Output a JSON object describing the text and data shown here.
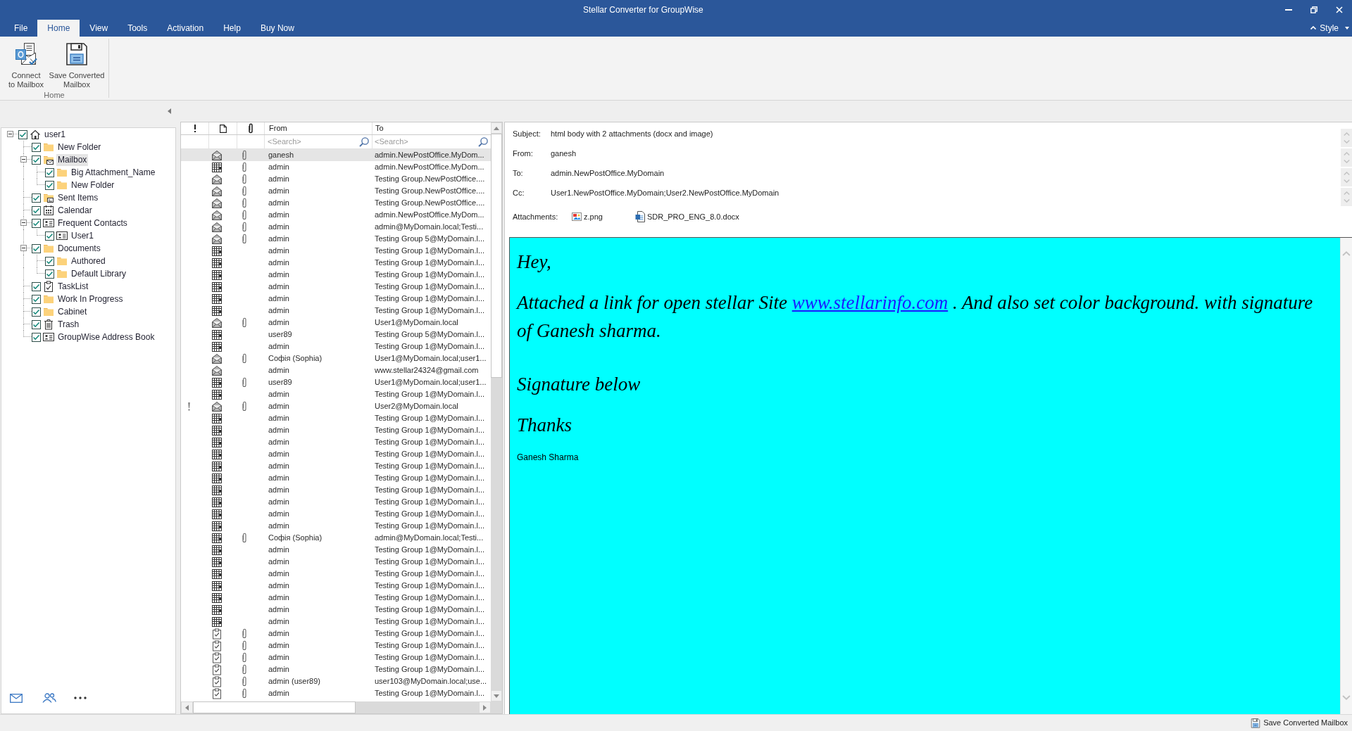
{
  "window": {
    "title": "Stellar Converter for GroupWise"
  },
  "menu_tabs": [
    {
      "label": "File",
      "selected": false
    },
    {
      "label": "Home",
      "selected": true
    },
    {
      "label": "View",
      "selected": false
    },
    {
      "label": "Tools",
      "selected": false
    },
    {
      "label": "Activation",
      "selected": false
    },
    {
      "label": "Help",
      "selected": false
    },
    {
      "label": "Buy Now",
      "selected": false
    }
  ],
  "style_menu": {
    "label": "Style"
  },
  "ribbon": {
    "buttons": [
      {
        "kind": "connect",
        "label_lines": [
          "Connect",
          "to Mailbox"
        ]
      },
      {
        "kind": "save",
        "label_lines": [
          "Save Converted",
          "Mailbox"
        ]
      }
    ],
    "group_label": "Home"
  },
  "folder_tree": [
    {
      "label": "user1",
      "kind": "user",
      "checked": true,
      "expanded": true,
      "selected": false,
      "children": [
        {
          "label": "New Folder",
          "kind": "folder",
          "checked": true,
          "selected": false
        },
        {
          "label": "Mailbox",
          "kind": "mailbox",
          "checked": true,
          "expanded": true,
          "selected": true,
          "children": [
            {
              "label": "Big Attachment_Name",
              "kind": "folder",
              "checked": true,
              "selected": false
            },
            {
              "label": "New Folder",
              "kind": "folder",
              "checked": true,
              "selected": false
            }
          ]
        },
        {
          "label": "Sent Items",
          "kind": "sent",
          "checked": true,
          "selected": false
        },
        {
          "label": "Calendar",
          "kind": "calendar",
          "checked": true,
          "selected": false
        },
        {
          "label": "Frequent Contacts",
          "kind": "contacts",
          "checked": true,
          "expanded": true,
          "selected": false,
          "children": [
            {
              "label": "User1",
              "kind": "contacts",
              "checked": true,
              "selected": false
            }
          ]
        },
        {
          "label": "Documents",
          "kind": "folder",
          "checked": true,
          "expanded": true,
          "selected": false,
          "children": [
            {
              "label": "Authored",
              "kind": "folder",
              "checked": true,
              "selected": false
            },
            {
              "label": "Default Library",
              "kind": "folder",
              "checked": true,
              "selected": false
            }
          ]
        },
        {
          "label": "TaskList",
          "kind": "tasks",
          "checked": true,
          "selected": false
        },
        {
          "label": "Work In Progress",
          "kind": "folder",
          "checked": true,
          "selected": false
        },
        {
          "label": "Cabinet",
          "kind": "folder",
          "checked": true,
          "selected": false
        },
        {
          "label": "Trash",
          "kind": "trash",
          "checked": true,
          "selected": false
        },
        {
          "label": "GroupWise Address Book",
          "kind": "contacts",
          "checked": true,
          "selected": false
        }
      ]
    }
  ],
  "message_list": {
    "columns": [
      {
        "label": "From"
      },
      {
        "label": "To"
      }
    ],
    "search": [
      {
        "placeholder": "<Search>"
      },
      {
        "placeholder": "<Search>"
      }
    ],
    "rows": [
      {
        "from": "ganesh",
        "to": "admin.NewPostOffice.MyDom...",
        "kind": "mail",
        "attachment": true,
        "important": false,
        "selected": true
      },
      {
        "from": "admin",
        "to": "admin.NewPostOffice.MyDom...",
        "kind": "appointment",
        "attachment": true,
        "important": false,
        "selected": false
      },
      {
        "from": "admin",
        "to": "Testing Group.NewPostOffice....",
        "kind": "mail",
        "attachment": true,
        "important": false,
        "selected": false
      },
      {
        "from": "admin",
        "to": "Testing Group.NewPostOffice....",
        "kind": "mail",
        "attachment": true,
        "important": false,
        "selected": false
      },
      {
        "from": "admin",
        "to": "Testing Group.NewPostOffice....",
        "kind": "mail",
        "attachment": true,
        "important": false,
        "selected": false
      },
      {
        "from": "admin",
        "to": "admin.NewPostOffice.MyDom...",
        "kind": "mail",
        "attachment": true,
        "important": false,
        "selected": false
      },
      {
        "from": "admin",
        "to": "admin@MyDomain.local;Testi...",
        "kind": "mail",
        "attachment": true,
        "important": false,
        "selected": false
      },
      {
        "from": "admin",
        "to": "Testing Group 5@MyDomain.l...",
        "kind": "mail",
        "attachment": true,
        "important": false,
        "selected": false
      },
      {
        "from": "admin",
        "to": "Testing Group 1@MyDomain.l...",
        "kind": "appointment",
        "attachment": false,
        "important": false,
        "selected": false
      },
      {
        "from": "admin",
        "to": "Testing Group 1@MyDomain.l...",
        "kind": "appointment",
        "attachment": false,
        "important": false,
        "selected": false
      },
      {
        "from": "admin",
        "to": "Testing Group 1@MyDomain.l...",
        "kind": "appointment",
        "attachment": false,
        "important": false,
        "selected": false
      },
      {
        "from": "admin",
        "to": "Testing Group 1@MyDomain.l...",
        "kind": "appointment",
        "attachment": false,
        "important": false,
        "selected": false
      },
      {
        "from": "admin",
        "to": "Testing Group 1@MyDomain.l...",
        "kind": "appointment",
        "attachment": false,
        "important": false,
        "selected": false
      },
      {
        "from": "admin",
        "to": "Testing Group 1@MyDomain.l...",
        "kind": "appointment",
        "attachment": false,
        "important": false,
        "selected": false
      },
      {
        "from": "admin",
        "to": "User1@MyDomain.local",
        "kind": "mail",
        "attachment": true,
        "important": false,
        "selected": false
      },
      {
        "from": "user89",
        "to": "Testing Group 5@MyDomain.l...",
        "kind": "appointment",
        "attachment": false,
        "important": false,
        "selected": false
      },
      {
        "from": "admin",
        "to": "Testing Group 1@MyDomain.l...",
        "kind": "appointment",
        "attachment": false,
        "important": false,
        "selected": false
      },
      {
        "from": "Софія (Sophia)",
        "to": "User1@MyDomain.local;user1...",
        "kind": "mail",
        "attachment": true,
        "important": false,
        "selected": false
      },
      {
        "from": "admin",
        "to": "www.stellar24324@gmail.com",
        "kind": "mail",
        "attachment": false,
        "important": false,
        "selected": false
      },
      {
        "from": "user89",
        "to": "User1@MyDomain.local;user1...",
        "kind": "appointment",
        "attachment": true,
        "important": false,
        "selected": false
      },
      {
        "from": "admin",
        "to": "Testing Group 1@MyDomain.l...",
        "kind": "appointment",
        "attachment": false,
        "important": false,
        "selected": false
      },
      {
        "from": "admin",
        "to": "User2@MyDomain.local",
        "kind": "mail",
        "attachment": true,
        "important": true,
        "selected": false
      },
      {
        "from": "admin",
        "to": "Testing Group 1@MyDomain.l...",
        "kind": "appointment",
        "attachment": false,
        "important": false,
        "selected": false
      },
      {
        "from": "admin",
        "to": "Testing Group 1@MyDomain.l...",
        "kind": "appointment",
        "attachment": false,
        "important": false,
        "selected": false
      },
      {
        "from": "admin",
        "to": "Testing Group 1@MyDomain.l...",
        "kind": "appointment",
        "attachment": false,
        "important": false,
        "selected": false
      },
      {
        "from": "admin",
        "to": "Testing Group 1@MyDomain.l...",
        "kind": "appointment",
        "attachment": false,
        "important": false,
        "selected": false
      },
      {
        "from": "admin",
        "to": "Testing Group 1@MyDomain.l...",
        "kind": "appointment",
        "attachment": false,
        "important": false,
        "selected": false
      },
      {
        "from": "admin",
        "to": "Testing Group 1@MyDomain.l...",
        "kind": "appointment",
        "attachment": false,
        "important": false,
        "selected": false
      },
      {
        "from": "admin",
        "to": "Testing Group 1@MyDomain.l...",
        "kind": "appointment",
        "attachment": false,
        "important": false,
        "selected": false
      },
      {
        "from": "admin",
        "to": "Testing Group 1@MyDomain.l...",
        "kind": "appointment",
        "attachment": false,
        "important": false,
        "selected": false
      },
      {
        "from": "admin",
        "to": "Testing Group 1@MyDomain.l...",
        "kind": "appointment",
        "attachment": false,
        "important": false,
        "selected": false
      },
      {
        "from": "admin",
        "to": "Testing Group 1@MyDomain.l...",
        "kind": "appointment",
        "attachment": false,
        "important": false,
        "selected": false
      },
      {
        "from": "Софія (Sophia)",
        "to": "admin@MyDomain.local;Testi...",
        "kind": "appointment",
        "attachment": true,
        "important": false,
        "selected": false
      },
      {
        "from": "admin",
        "to": "Testing Group 1@MyDomain.l...",
        "kind": "appointment",
        "attachment": false,
        "important": false,
        "selected": false
      },
      {
        "from": "admin",
        "to": "Testing Group 1@MyDomain.l...",
        "kind": "appointment",
        "attachment": false,
        "important": false,
        "selected": false
      },
      {
        "from": "admin",
        "to": "Testing Group 1@MyDomain.l...",
        "kind": "appointment",
        "attachment": false,
        "important": false,
        "selected": false
      },
      {
        "from": "admin",
        "to": "Testing Group 1@MyDomain.l...",
        "kind": "appointment",
        "attachment": false,
        "important": false,
        "selected": false
      },
      {
        "from": "admin",
        "to": "Testing Group 1@MyDomain.l...",
        "kind": "appointment",
        "attachment": false,
        "important": false,
        "selected": false
      },
      {
        "from": "admin",
        "to": "Testing Group 1@MyDomain.l...",
        "kind": "appointment",
        "attachment": false,
        "important": false,
        "selected": false
      },
      {
        "from": "admin",
        "to": "Testing Group 1@MyDomain.l...",
        "kind": "appointment",
        "attachment": false,
        "important": false,
        "selected": false
      },
      {
        "from": "admin",
        "to": "Testing Group 1@MyDomain.l...",
        "kind": "task",
        "attachment": true,
        "important": false,
        "selected": false
      },
      {
        "from": "admin",
        "to": "Testing Group 1@MyDomain.l...",
        "kind": "task",
        "attachment": true,
        "important": false,
        "selected": false
      },
      {
        "from": "admin",
        "to": "Testing Group 1@MyDomain.l...",
        "kind": "task",
        "attachment": true,
        "important": false,
        "selected": false
      },
      {
        "from": "admin",
        "to": "Testing Group 1@MyDomain.l...",
        "kind": "task",
        "attachment": true,
        "important": false,
        "selected": false
      },
      {
        "from": "admin (user89)",
        "to": "user103@MyDomain.local;use...",
        "kind": "task",
        "attachment": true,
        "important": false,
        "selected": false
      },
      {
        "from": "admin",
        "to": "Testing Group 1@MyDomain.l...",
        "kind": "task",
        "attachment": true,
        "important": false,
        "selected": false
      }
    ]
  },
  "preview": {
    "fields": [
      {
        "label": "Subject:",
        "value": "html body with 2 attachments (docx and image)"
      },
      {
        "label": "From:",
        "value": "ganesh"
      },
      {
        "label": "To:",
        "value": "admin.NewPostOffice.MyDomain"
      },
      {
        "label": "Cc:",
        "value": "User1.NewPostOffice.MyDomain;User2.NewPostOffice.MyDomain"
      }
    ],
    "attachments_label": "Attachments:",
    "attachments": [
      {
        "name": "z.png",
        "kind": "image"
      },
      {
        "name": "SDR_PRO_ENG_8.0.docx",
        "kind": "document"
      }
    ],
    "body": [
      {
        "kind": "script",
        "text": "Hey,"
      },
      {
        "kind": "script-link",
        "before": "Attached a link for open stellar Site",
        "link": "www.stellarinfo.com",
        "after": ". And also set color background. with signature of Ganesh sharma."
      },
      {
        "kind": "script",
        "text": "Signature below"
      },
      {
        "kind": "script",
        "text": "Thanks"
      },
      {
        "kind": "plain",
        "text": "Ganesh Sharma"
      }
    ]
  },
  "status_bar": {
    "button": "Save Converted Mailbox"
  }
}
